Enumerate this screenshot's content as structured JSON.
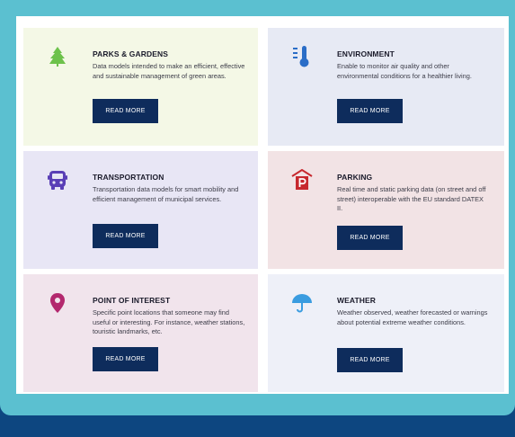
{
  "cards": [
    {
      "title": "PARKS & GARDENS",
      "desc": "Data models intended to make an efficient, effective and sustainable management of green areas.",
      "button": "READ MORE",
      "icon": "tree-icon",
      "color": "#6dc24b"
    },
    {
      "title": "ENVIRONMENT",
      "desc": "Enable to monitor air quality and other environmental conditions for a healthier living.",
      "button": "READ MORE",
      "icon": "thermometer-icon",
      "color": "#2a6dc7"
    },
    {
      "title": "TRANSPORTATION",
      "desc": "Transportation data models for smart mobility and efficient management of municipal services.",
      "button": "READ MORE",
      "icon": "bus-icon",
      "color": "#5a3fb6"
    },
    {
      "title": "PARKING",
      "desc": "Real time and static parking data (on street and off street) interoperable with the EU standard DATEX II.",
      "button": "READ MORE",
      "icon": "parking-icon",
      "color": "#c7282e"
    },
    {
      "title": "POINT OF INTEREST",
      "desc": "Specific point locations that someone may find useful or interesting. For instance, weather stations, touristic landmarks, etc.",
      "button": "READ MORE",
      "icon": "location-pin-icon",
      "color": "#b3286e"
    },
    {
      "title": "WEATHER",
      "desc": "Weather observed, weather forecasted or warnings about potential extreme weather conditions.",
      "button": "READ MORE",
      "icon": "umbrella-icon",
      "color": "#3a9ce0"
    }
  ]
}
